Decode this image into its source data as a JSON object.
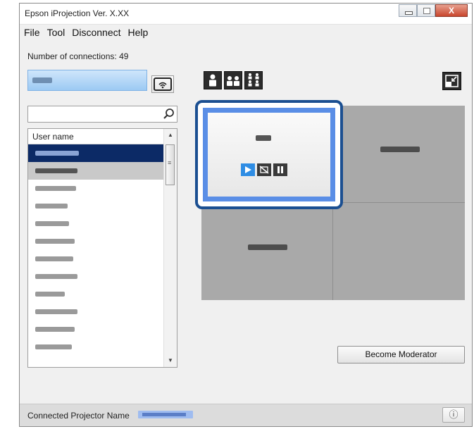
{
  "window": {
    "title": "Epson iProjection Ver. X.XX",
    "controls": {
      "minimize": "minimize",
      "maximize": "maximize",
      "close": "X"
    }
  },
  "menu": [
    "File",
    "Tool",
    "Disconnect",
    "Help"
  ],
  "connections": {
    "label": "Number of connections: 49"
  },
  "search": {
    "value": "",
    "placeholder": ""
  },
  "user_list": {
    "header": "User name",
    "selected_rows": [
      0,
      1
    ]
  },
  "layout_buttons": [
    "1-person-layout-icon",
    "2-person-layout-icon",
    "4-person-layout-icon"
  ],
  "moderator_button": "Become Moderator",
  "status": {
    "label": "Connected Projector Name",
    "info_icon": "ⓘ"
  },
  "colors": {
    "selection": "#0c2a66",
    "active_frame": "#1b4f91",
    "active_border": "#5a8ee6",
    "grid_bg": "#a9a9a9"
  }
}
